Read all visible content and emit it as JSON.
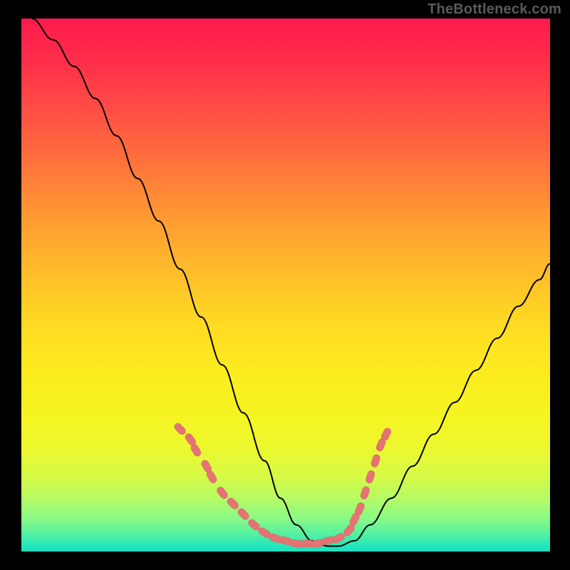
{
  "watermark": "TheBottleneck.com",
  "chart_data": {
    "type": "line",
    "title": "",
    "xlabel": "",
    "ylabel": "",
    "xlim": [
      0,
      100
    ],
    "ylim": [
      0,
      100
    ],
    "background_gradient": [
      "#ff1a4d",
      "#ff8a36",
      "#ffdc22",
      "#eef82c",
      "#4ff0a5",
      "#1be0c2"
    ],
    "series": [
      {
        "name": "curve",
        "color": "#000000",
        "x": [
          2,
          6,
          10,
          14,
          18,
          22,
          26,
          30,
          34,
          38,
          42,
          46,
          49,
          52,
          55,
          58,
          60,
          63,
          66,
          70,
          74,
          78,
          82,
          86,
          90,
          94,
          98,
          100
        ],
        "y": [
          100,
          96,
          91,
          85,
          78,
          70,
          62,
          53,
          44,
          35,
          26,
          17,
          10,
          5,
          2,
          1,
          1,
          2,
          5,
          10,
          16,
          22,
          28,
          34,
          40,
          46,
          51,
          54
        ]
      }
    ],
    "markers": {
      "name": "highlighted-points",
      "color": "#e57373",
      "points": [
        {
          "x": 30,
          "y": 23
        },
        {
          "x": 32,
          "y": 21
        },
        {
          "x": 33,
          "y": 19
        },
        {
          "x": 35,
          "y": 16
        },
        {
          "x": 36,
          "y": 14
        },
        {
          "x": 38,
          "y": 11
        },
        {
          "x": 40,
          "y": 9
        },
        {
          "x": 42,
          "y": 7
        },
        {
          "x": 44,
          "y": 5
        },
        {
          "x": 46,
          "y": 3.5
        },
        {
          "x": 48,
          "y": 2.5
        },
        {
          "x": 50,
          "y": 2
        },
        {
          "x": 52,
          "y": 1.5
        },
        {
          "x": 54,
          "y": 1.5
        },
        {
          "x": 56,
          "y": 1.5
        },
        {
          "x": 58,
          "y": 2
        },
        {
          "x": 60,
          "y": 2.5
        },
        {
          "x": 62,
          "y": 4
        },
        {
          "x": 63,
          "y": 6
        },
        {
          "x": 64,
          "y": 8
        },
        {
          "x": 65,
          "y": 11
        },
        {
          "x": 66,
          "y": 14
        },
        {
          "x": 67,
          "y": 17
        },
        {
          "x": 68,
          "y": 20
        },
        {
          "x": 69,
          "y": 22
        }
      ]
    }
  }
}
